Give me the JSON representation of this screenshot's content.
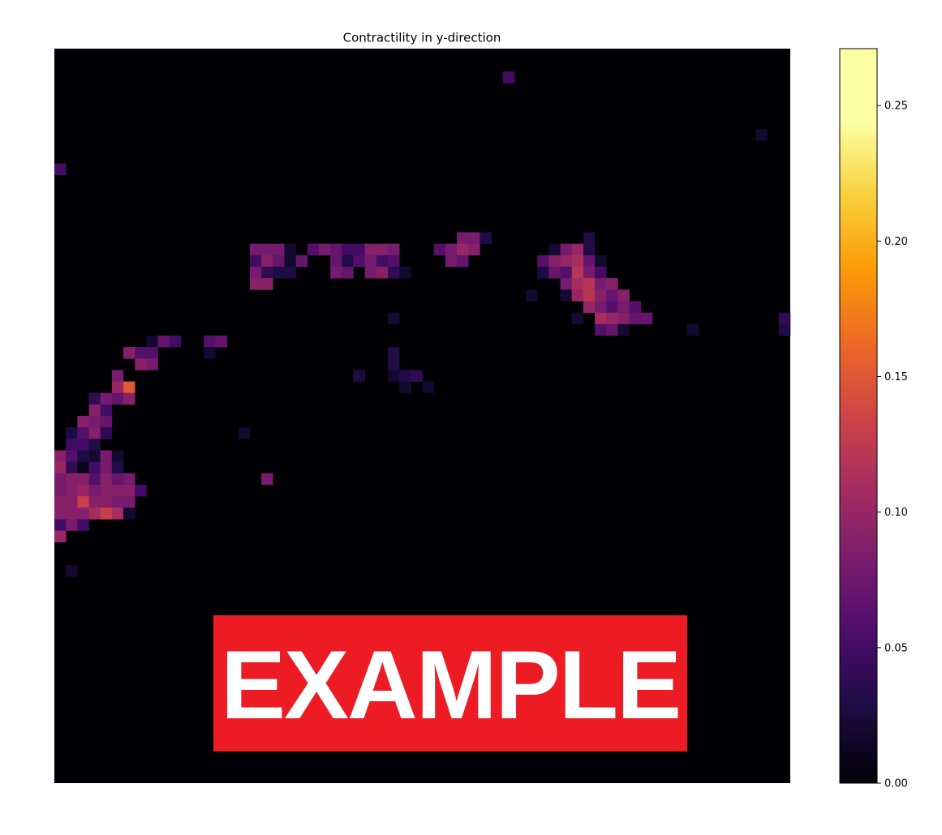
{
  "chart_data": {
    "type": "heatmap",
    "title": "Contractility in y-direction",
    "colormap": "inferno",
    "grid": false,
    "axes_visible": false,
    "grid_shape": [
      64,
      64
    ],
    "background_value": 0.0,
    "colorbar": {
      "range": [
        0.0,
        0.271
      ],
      "ticks": [
        0.0,
        0.05,
        0.1,
        0.15,
        0.2,
        0.25
      ],
      "tick_labels": [
        "0.00",
        "0.05",
        "0.10",
        "0.15",
        "0.20",
        "0.25"
      ]
    },
    "cells": [
      [
        39,
        2,
        0.05
      ],
      [
        61,
        7,
        0.02
      ],
      [
        0,
        10,
        0.05
      ],
      [
        35,
        16,
        0.08
      ],
      [
        36,
        16,
        0.08
      ],
      [
        37,
        16,
        0.03
      ],
      [
        46,
        16,
        0.03
      ],
      [
        17,
        17,
        0.08
      ],
      [
        18,
        17,
        0.08
      ],
      [
        19,
        17,
        0.08
      ],
      [
        20,
        17,
        0.02
      ],
      [
        22,
        17,
        0.06
      ],
      [
        23,
        17,
        0.08
      ],
      [
        24,
        17,
        0.07
      ],
      [
        25,
        17,
        0.05
      ],
      [
        26,
        17,
        0.05
      ],
      [
        27,
        17,
        0.09
      ],
      [
        28,
        17,
        0.09
      ],
      [
        29,
        17,
        0.08
      ],
      [
        33,
        17,
        0.06
      ],
      [
        34,
        17,
        0.08
      ],
      [
        35,
        17,
        0.1
      ],
      [
        36,
        17,
        0.09
      ],
      [
        43,
        17,
        0.02
      ],
      [
        44,
        17,
        0.08
      ],
      [
        45,
        17,
        0.1
      ],
      [
        46,
        17,
        0.03
      ],
      [
        17,
        18,
        0.05
      ],
      [
        18,
        18,
        0.09
      ],
      [
        19,
        18,
        0.07
      ],
      [
        20,
        18,
        0.02
      ],
      [
        21,
        18,
        0.07
      ],
      [
        24,
        18,
        0.07
      ],
      [
        25,
        18,
        0.03
      ],
      [
        26,
        18,
        0.06
      ],
      [
        27,
        18,
        0.08
      ],
      [
        28,
        18,
        0.05
      ],
      [
        29,
        18,
        0.06
      ],
      [
        34,
        18,
        0.08
      ],
      [
        35,
        18,
        0.07
      ],
      [
        42,
        18,
        0.06
      ],
      [
        43,
        18,
        0.09
      ],
      [
        44,
        18,
        0.1
      ],
      [
        45,
        18,
        0.11
      ],
      [
        46,
        18,
        0.07
      ],
      [
        47,
        18,
        0.02
      ],
      [
        17,
        19,
        0.08
      ],
      [
        18,
        19,
        0.04
      ],
      [
        19,
        19,
        0.03
      ],
      [
        20,
        19,
        0.03
      ],
      [
        24,
        19,
        0.08
      ],
      [
        25,
        19,
        0.07
      ],
      [
        27,
        19,
        0.08
      ],
      [
        28,
        19,
        0.09
      ],
      [
        29,
        19,
        0.04
      ],
      [
        30,
        19,
        0.02
      ],
      [
        42,
        19,
        0.03
      ],
      [
        43,
        19,
        0.07
      ],
      [
        44,
        19,
        0.06
      ],
      [
        45,
        19,
        0.12
      ],
      [
        46,
        19,
        0.08
      ],
      [
        47,
        19,
        0.05
      ],
      [
        17,
        20,
        0.09
      ],
      [
        18,
        20,
        0.09
      ],
      [
        44,
        20,
        0.08
      ],
      [
        45,
        20,
        0.11
      ],
      [
        46,
        20,
        0.12
      ],
      [
        47,
        20,
        0.08
      ],
      [
        48,
        20,
        0.09
      ],
      [
        41,
        21,
        0.02
      ],
      [
        44,
        21,
        0.02
      ],
      [
        45,
        21,
        0.1
      ],
      [
        46,
        21,
        0.12
      ],
      [
        47,
        21,
        0.09
      ],
      [
        48,
        21,
        0.07
      ],
      [
        49,
        21,
        0.09
      ],
      [
        46,
        22,
        0.1
      ],
      [
        47,
        22,
        0.08
      ],
      [
        48,
        22,
        0.06
      ],
      [
        49,
        22,
        0.08
      ],
      [
        50,
        22,
        0.06
      ],
      [
        29,
        23,
        0.02
      ],
      [
        45,
        23,
        0.02
      ],
      [
        47,
        23,
        0.11
      ],
      [
        48,
        23,
        0.1
      ],
      [
        49,
        23,
        0.09
      ],
      [
        50,
        23,
        0.07
      ],
      [
        51,
        23,
        0.07
      ],
      [
        63,
        23,
        0.04
      ],
      [
        47,
        24,
        0.06
      ],
      [
        48,
        24,
        0.07
      ],
      [
        49,
        24,
        0.02
      ],
      [
        55,
        24,
        0.02
      ],
      [
        63,
        24,
        0.03
      ],
      [
        8,
        25,
        0.02
      ],
      [
        9,
        25,
        0.07
      ],
      [
        10,
        25,
        0.05
      ],
      [
        13,
        25,
        0.06
      ],
      [
        14,
        25,
        0.07
      ],
      [
        6,
        26,
        0.09
      ],
      [
        7,
        26,
        0.06
      ],
      [
        8,
        26,
        0.06
      ],
      [
        13,
        26,
        0.02
      ],
      [
        29,
        26,
        0.03
      ],
      [
        7,
        27,
        0.09
      ],
      [
        8,
        27,
        0.08
      ],
      [
        29,
        27,
        0.03
      ],
      [
        5,
        28,
        0.08
      ],
      [
        26,
        28,
        0.03
      ],
      [
        29,
        28,
        0.02
      ],
      [
        30,
        28,
        0.03
      ],
      [
        31,
        28,
        0.04
      ],
      [
        5,
        29,
        0.1
      ],
      [
        6,
        29,
        0.15
      ],
      [
        30,
        29,
        0.02
      ],
      [
        32,
        29,
        0.02
      ],
      [
        3,
        30,
        0.04
      ],
      [
        4,
        30,
        0.08
      ],
      [
        5,
        30,
        0.07
      ],
      [
        6,
        30,
        0.09
      ],
      [
        3,
        31,
        0.09
      ],
      [
        4,
        31,
        0.05
      ],
      [
        2,
        32,
        0.09
      ],
      [
        3,
        32,
        0.08
      ],
      [
        4,
        32,
        0.07
      ],
      [
        1,
        33,
        0.03
      ],
      [
        2,
        33,
        0.06
      ],
      [
        3,
        33,
        0.09
      ],
      [
        4,
        33,
        0.04
      ],
      [
        16,
        33,
        0.02
      ],
      [
        1,
        34,
        0.05
      ],
      [
        2,
        34,
        0.05
      ],
      [
        3,
        34,
        0.03
      ],
      [
        0,
        35,
        0.09
      ],
      [
        1,
        35,
        0.06
      ],
      [
        2,
        35,
        0.03
      ],
      [
        3,
        35,
        0.02
      ],
      [
        4,
        35,
        0.08
      ],
      [
        5,
        35,
        0.02
      ],
      [
        0,
        36,
        0.1
      ],
      [
        1,
        36,
        0.04
      ],
      [
        2,
        36,
        0.01
      ],
      [
        3,
        36,
        0.05
      ],
      [
        4,
        36,
        0.08
      ],
      [
        5,
        36,
        0.03
      ],
      [
        0,
        37,
        0.08
      ],
      [
        1,
        37,
        0.09
      ],
      [
        2,
        37,
        0.09
      ],
      [
        3,
        37,
        0.06
      ],
      [
        4,
        37,
        0.09
      ],
      [
        5,
        37,
        0.07
      ],
      [
        6,
        37,
        0.08
      ],
      [
        18,
        37,
        0.08
      ],
      [
        0,
        38,
        0.08
      ],
      [
        1,
        38,
        0.09
      ],
      [
        2,
        38,
        0.1
      ],
      [
        3,
        38,
        0.08
      ],
      [
        4,
        38,
        0.09
      ],
      [
        5,
        38,
        0.09
      ],
      [
        6,
        38,
        0.09
      ],
      [
        7,
        38,
        0.05
      ],
      [
        0,
        39,
        0.09
      ],
      [
        1,
        39,
        0.09
      ],
      [
        2,
        39,
        0.13
      ],
      [
        3,
        39,
        0.09
      ],
      [
        4,
        39,
        0.09
      ],
      [
        5,
        39,
        0.08
      ],
      [
        6,
        39,
        0.08
      ],
      [
        0,
        40,
        0.09
      ],
      [
        1,
        40,
        0.09
      ],
      [
        2,
        40,
        0.09
      ],
      [
        3,
        40,
        0.11
      ],
      [
        4,
        40,
        0.13
      ],
      [
        5,
        40,
        0.11
      ],
      [
        6,
        40,
        0.02
      ],
      [
        0,
        41,
        0.05
      ],
      [
        1,
        41,
        0.08
      ],
      [
        2,
        41,
        0.05
      ],
      [
        0,
        42,
        0.1
      ],
      [
        1,
        45,
        0.02
      ]
    ]
  },
  "watermark": {
    "text": "EXAMPLE"
  }
}
